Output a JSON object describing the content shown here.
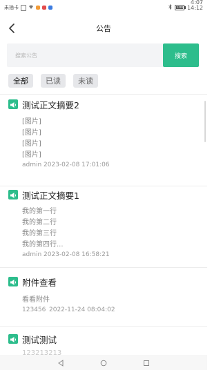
{
  "statusbar": {
    "carrier": "未插卡",
    "clock_left": "4:07",
    "battery": "100",
    "clock_right": "14:12"
  },
  "header": {
    "title": "公告"
  },
  "search": {
    "placeholder": "搜索公告",
    "button_label": "搜索"
  },
  "filters": [
    {
      "label": "全部",
      "active": true
    },
    {
      "label": "已读",
      "active": false
    },
    {
      "label": "未读",
      "active": false
    }
  ],
  "announcements": [
    {
      "title": "测试正文摘要2",
      "lines": [
        "[图片]",
        "[图片]",
        "[图片]",
        "[图片]"
      ],
      "author": "admin",
      "time": "2023-02-08 17:01:06"
    },
    {
      "title": "测试正文摘要1",
      "lines": [
        "我的第一行",
        "我的第二行",
        "我的第三行",
        "我的第四行..."
      ],
      "author": "admin",
      "time": "2023-02-08 16:58:21"
    },
    {
      "title": "附件查看",
      "lines": [
        "看看附件"
      ],
      "author": "123456",
      "time": "2022-11-24 08:04:02"
    },
    {
      "title": "测试测试",
      "lines": [
        "123213213"
      ],
      "author": "",
      "time": ""
    }
  ],
  "colors": {
    "accent": "#2dbd8c"
  },
  "icons": {
    "back": "chevron-left-icon",
    "announcement": "megaphone-icon"
  }
}
